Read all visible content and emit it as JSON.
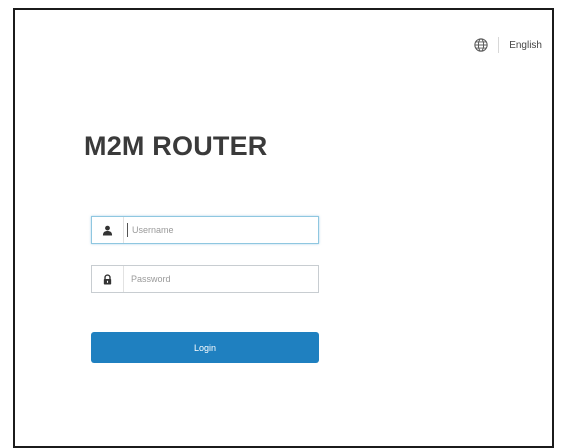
{
  "header": {
    "language_icon": "globe-icon",
    "language_label": "English"
  },
  "brand": {
    "title": "M2M ROUTER"
  },
  "login_form": {
    "username": {
      "icon": "user-icon",
      "placeholder": "Username",
      "value": ""
    },
    "password": {
      "icon": "lock-icon",
      "placeholder": "Password",
      "value": ""
    },
    "submit_label": "Login"
  },
  "colors": {
    "accent": "#1f80c0",
    "title": "#3a3a3a",
    "border": "#1b1b1b"
  }
}
